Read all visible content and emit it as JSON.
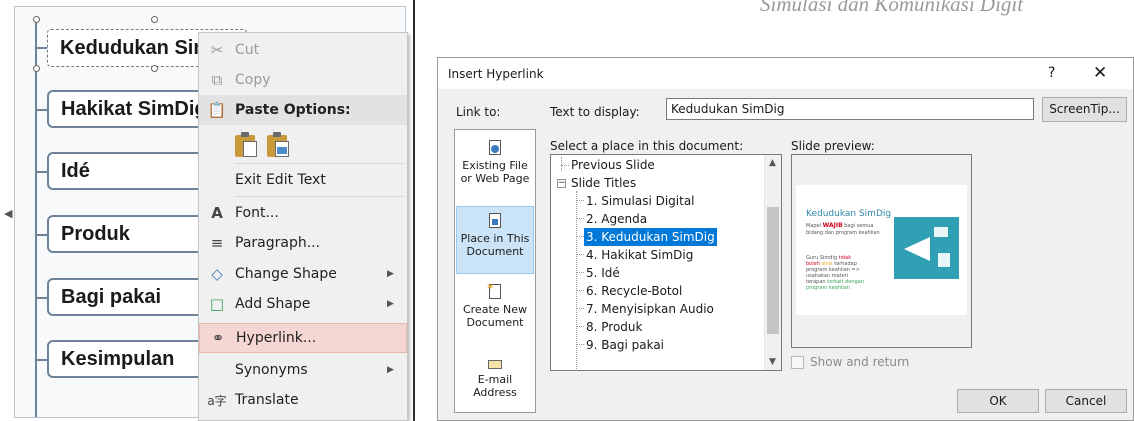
{
  "slide_heading": "Simulasi dan Komunikasi Digit",
  "smartart": {
    "items": [
      "Kedudukan Sim",
      "Hakikat SimDig",
      "Idé",
      "Produk",
      "Bagi pakai",
      "Kesimpulan"
    ]
  },
  "context_menu": {
    "cut": "Cut",
    "copy": "Copy",
    "paste_options": "Paste Options:",
    "exit_edit_text": "Exit Edit Text",
    "font": "Font...",
    "paragraph": "Paragraph...",
    "change_shape": "Change Shape",
    "add_shape": "Add Shape",
    "hyperlink": "Hyperlink...",
    "synonyms": "Synonyms",
    "translate": "Translate"
  },
  "dialog": {
    "title": "Insert Hyperlink",
    "help": "?",
    "close": "✕",
    "link_to_label": "Link to:",
    "text_to_display_label": "Text to display:",
    "text_to_display_value": "Kedudukan SimDig",
    "screentip_button": "ScreenTip...",
    "link_to_options": [
      {
        "line1": "Existing File",
        "line2": "or Web Page"
      },
      {
        "line1": "Place in This",
        "line2": "Document"
      },
      {
        "line1": "Create New",
        "line2": "Document"
      },
      {
        "line1": "E-mail",
        "line2": "Address"
      }
    ],
    "select_place_label": "Select a place in this document:",
    "document_tree": {
      "previous_slide": "Previous Slide",
      "slide_titles": "Slide Titles",
      "slides": [
        "1. Simulasi Digital",
        "2. Agenda",
        "3. Kedudukan SimDig",
        "4. Hakikat SimDig",
        "5. Idé",
        "6. Recycle-Botol",
        "7. Menyisipkan Audio",
        "8. Produk",
        "9. Bagi pakai"
      ],
      "selected_index": 2
    },
    "slide_preview_label": "Slide preview:",
    "preview": {
      "title": "Kedudukan SimDig",
      "mapel": "Mapel",
      "wajib": "WAJIB",
      "line1_rest": "bagi semua",
      "line2": "bidang dan program keahlian",
      "block_prefix": "Guru Simdig",
      "block_red": "tidak boleh",
      "block_mid1": "sinis",
      "block_mid2": "terhadap program keahlian => usahakan materi terapan",
      "block_green": "terkait dengan program keahlian"
    },
    "show_and_return": "Show and return",
    "ok_button": "OK",
    "cancel_button": "Cancel"
  }
}
